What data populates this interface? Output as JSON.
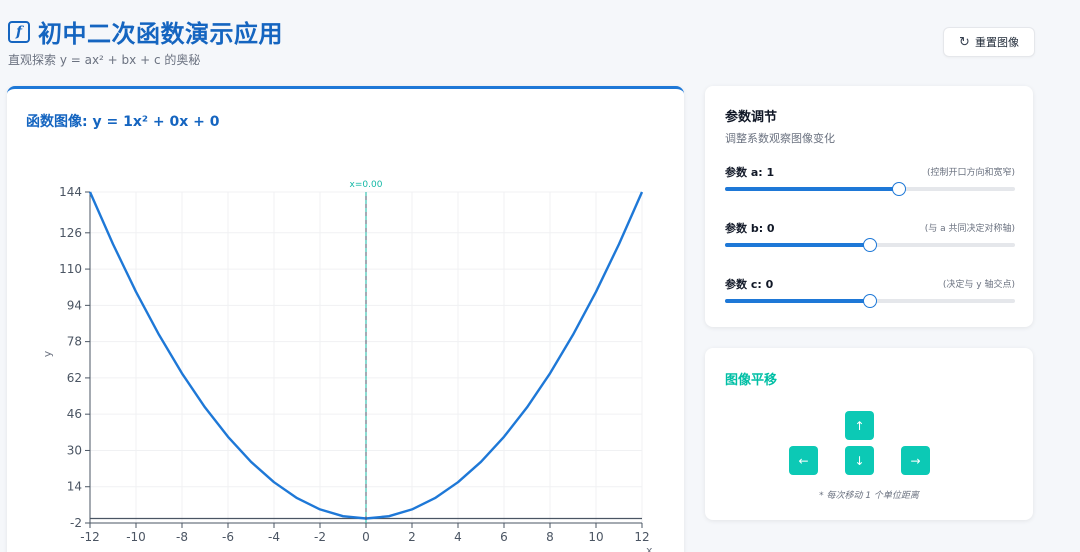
{
  "header": {
    "logo_icon": "f",
    "title": "初中二次函数演示应用",
    "subtitle": "直观探索 y = ax² + bx + c 的奥秘"
  },
  "toolbar": {
    "reset_icon": "↻",
    "reset_label": "重置图像"
  },
  "chart_card": {
    "title": "函数图像: y = 1x² + 0x + 0"
  },
  "params": {
    "title": "参数调节",
    "desc": "调整系数观察图像变化",
    "a": {
      "label": "参数 a: 1",
      "hint": "(控制开口方向和宽窄)",
      "value": 1,
      "fraction": 0.6
    },
    "b": {
      "label": "参数 b: 0",
      "hint": "(与 a 共同决定对称轴)",
      "value": 0,
      "fraction": 0.5
    },
    "c": {
      "label": "参数 c: 0",
      "hint": "(决定与 y 轴交点)",
      "value": 0,
      "fraction": 0.5
    }
  },
  "shift": {
    "title": "图像平移",
    "up": "↑",
    "left": "←",
    "down": "↓",
    "right": "→",
    "note": "* 每次移动 1 个单位距离"
  },
  "colors": {
    "accent": "#1e78d7",
    "teal": "#0cc9b5",
    "curve": "#1e78d7",
    "axis_line": "#4a5563"
  },
  "chart_data": {
    "type": "line",
    "title": "函数图像: y = 1x² + 0x + 0",
    "xlabel": "x",
    "ylabel": "y",
    "xlim": [
      -12,
      12
    ],
    "ylim": [
      -2,
      144
    ],
    "x_ticks": [
      -12,
      -10,
      -8,
      -6,
      -4,
      -2,
      0,
      2,
      4,
      6,
      8,
      10,
      12
    ],
    "y_ticks": [
      -2,
      14,
      30,
      46,
      62,
      78,
      94,
      110,
      126,
      144
    ],
    "axis_of_symmetry_label": "x=0.00",
    "axis_of_symmetry_x": 0,
    "coefficients": {
      "a": 1,
      "b": 0,
      "c": 0
    },
    "series": [
      {
        "x": [
          -12,
          -11,
          -10,
          -9,
          -8,
          -7,
          -6,
          -5,
          -4,
          -3,
          -2,
          -1,
          0,
          1,
          2,
          3,
          4,
          5,
          6,
          7,
          8,
          9,
          10,
          11,
          12
        ],
        "values": [
          144,
          121,
          100,
          81,
          64,
          49,
          36,
          25,
          16,
          9,
          4,
          1,
          0,
          1,
          4,
          9,
          16,
          25,
          36,
          49,
          64,
          81,
          100,
          121,
          144
        ]
      }
    ],
    "grid": true
  }
}
